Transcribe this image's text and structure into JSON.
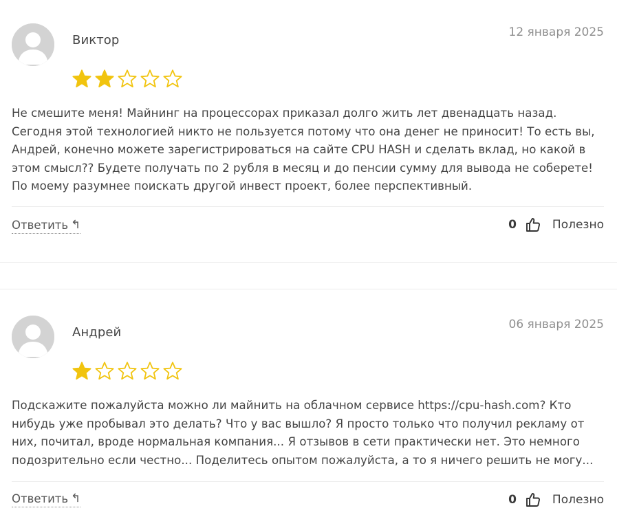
{
  "reviews": [
    {
      "author": "Виктор",
      "date": "12 января 2025",
      "rating": 2,
      "max_rating": 5,
      "text": "Не смешите меня! Майнинг на процессорах приказал долго жить лет двенадцать назад. Сегодня этой технологией никто не пользуется потому что она денег не приносит! То есть вы, Андрей, конечно можете зарегистрироваться на сайте CPU HASH и сделать вклад, но какой в этом смысл?? Будете получать по 2 рубля в месяц и до пенсии сумму для вывода не соберете! По моему разумнее поискать другой инвест проект, более перспективный.",
      "reply_label": "Ответить",
      "reply_icon": "reply-arrow-icon",
      "useful_count": "0",
      "useful_label": "Полезно",
      "useful_icon": "thumbs-up-icon"
    },
    {
      "author": "Андрей",
      "date": "06 января 2025",
      "rating": 1,
      "max_rating": 5,
      "text": "Подскажите пожалуйста можно ли майнить на облачном сервисе https://cpu-hash.com? Кто нибудь уже пробывал это делать? Что у вас вышло? Я просто только что получил рекламу от них, почитал, вроде нормальная компания... Я отзывов в сети практически нет. Это немного подозрительно если честно... Поделитесь опытом пожалуйста, а то я ничего решить не могу...",
      "reply_label": "Ответить",
      "reply_icon": "reply-arrow-icon",
      "useful_count": "0",
      "useful_label": "Полезно",
      "useful_icon": "thumbs-up-icon"
    }
  ],
  "colors": {
    "star_fill": "#f1c40f",
    "star_outline": "#f1c40f",
    "avatar_bg": "#d8d8d8",
    "avatar_fg": "#ffffff",
    "date": "#8f8f8f",
    "text": "#444444"
  }
}
